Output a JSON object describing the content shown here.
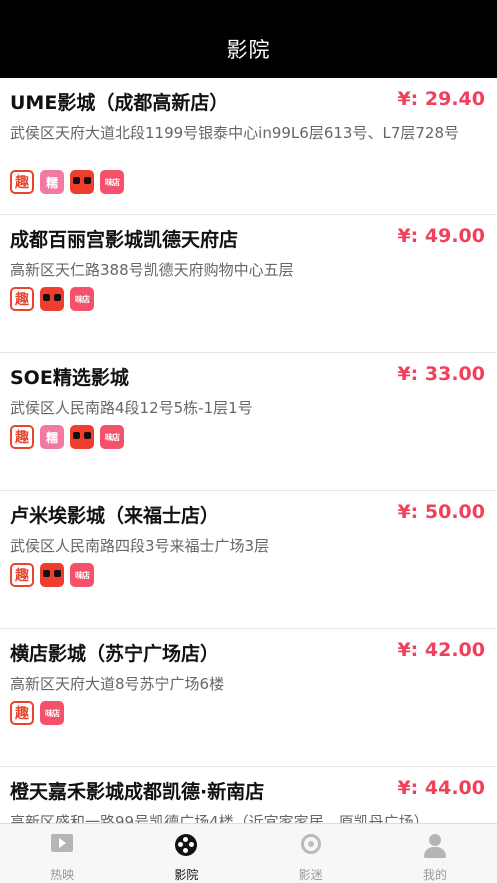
{
  "header": {
    "title": "影院"
  },
  "cinemas": [
    {
      "name": "UME影城（成都高新店）",
      "price": "¥: 29.40",
      "address": "武侯区天府大道北段1199号银泰中心in99L6层613号、L7层728号",
      "badges": [
        "趣",
        "糯",
        "猫眼",
        "味店"
      ]
    },
    {
      "name": "成都百丽宫影城凯德天府店",
      "price": "¥: 49.00",
      "address": "高新区天仁路388号凯德天府购物中心五层",
      "badges": [
        "趣",
        "猫眼",
        "味店"
      ]
    },
    {
      "name": "SOE精选影城",
      "price": "¥: 33.00",
      "address": "武侯区人民南路4段12号5栋-1层1号",
      "badges": [
        "趣",
        "糯",
        "猫眼",
        "味店"
      ]
    },
    {
      "name": "卢米埃影城（来福士店）",
      "price": "¥: 50.00",
      "address": "武侯区人民南路四段3号来福士广场3层",
      "badges": [
        "趣",
        "猫眼",
        "味店"
      ]
    },
    {
      "name": "横店影城（苏宁广场店）",
      "price": "¥: 42.00",
      "address": "高新区天府大道8号苏宁广场6楼",
      "badges": [
        "趣",
        "味店"
      ]
    },
    {
      "name": "橙天嘉禾影城成都凯德·新南店",
      "price": "¥: 44.00",
      "address": "高新区盛和一路99号凯德广场4楼（近宜家家居、原凯丹广场）",
      "badges": []
    }
  ],
  "tabbar": [
    {
      "label": "热映",
      "icon": "film-icon",
      "active": false
    },
    {
      "label": "影院",
      "icon": "reel-icon",
      "active": true
    },
    {
      "label": "影迷",
      "icon": "fan-icon",
      "active": false
    },
    {
      "label": "我的",
      "icon": "user-icon",
      "active": false
    }
  ],
  "colors": {
    "header_bg": "#000000",
    "price": "#f0405c",
    "active_tab": "#111111"
  }
}
